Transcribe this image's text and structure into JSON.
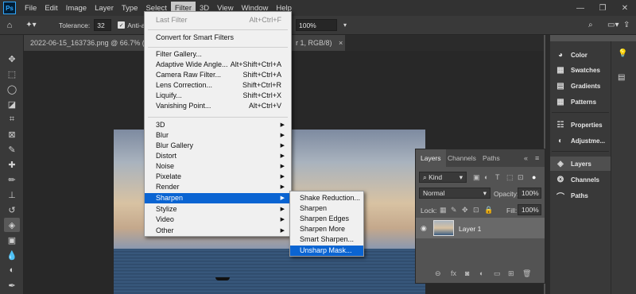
{
  "menubar": {
    "logo": "Ps",
    "items": [
      "File",
      "Edit",
      "Image",
      "Layer",
      "Type",
      "Select",
      "Filter",
      "3D",
      "View",
      "Window",
      "Help"
    ],
    "active": "Filter",
    "minimize": "—",
    "maximize": "❐",
    "close": "✕"
  },
  "options": {
    "tolerance_label": "Tolerance:",
    "tolerance_value": "32",
    "antialias_label": "Anti-alia",
    "opacity_value": "100%"
  },
  "tabs": {
    "doc1": "2022-06-15_163736.png @ 66.7% (RGB/",
    "doc2": "r 1, RGB/8)",
    "close": "×"
  },
  "filter_menu": {
    "last_filter": "Last Filter",
    "last_filter_sc": "Alt+Ctrl+F",
    "smart_filters": "Convert for Smart Filters",
    "items": [
      {
        "label": "Filter Gallery...",
        "sc": ""
      },
      {
        "label": "Adaptive Wide Angle...",
        "sc": "Alt+Shift+Ctrl+A"
      },
      {
        "label": "Camera Raw Filter...",
        "sc": "Shift+Ctrl+A"
      },
      {
        "label": "Lens Correction...",
        "sc": "Shift+Ctrl+R"
      },
      {
        "label": "Liquify...",
        "sc": "Shift+Ctrl+X"
      },
      {
        "label": "Vanishing Point...",
        "sc": "Alt+Ctrl+V"
      }
    ],
    "groups": [
      "3D",
      "Blur",
      "Blur Gallery",
      "Distort",
      "Noise",
      "Pixelate",
      "Render",
      "Sharpen",
      "Stylize",
      "Video",
      "Other"
    ],
    "highlighted": "Sharpen"
  },
  "sharpen_submenu": {
    "items": [
      "Shake Reduction...",
      "Sharpen",
      "Sharpen Edges",
      "Sharpen More",
      "Smart Sharpen...",
      "Unsharp Mask..."
    ],
    "highlighted": "Unsharp Mask..."
  },
  "layers_panel": {
    "tabs": [
      "Layers",
      "Channels",
      "Paths"
    ],
    "active_tab": "Layers",
    "kind": "Kind",
    "blend_mode": "Normal",
    "opacity_label": "Opacity:",
    "opacity_value": "100%",
    "lock_label": "Lock:",
    "fill_label": "Fill:",
    "fill_value": "100%",
    "layer_name": "Layer 1"
  },
  "right_dock": {
    "items": [
      "Color",
      "Swatches",
      "Gradients",
      "Patterns",
      "Properties",
      "Adjustme...",
      "Layers",
      "Channels",
      "Paths"
    ],
    "active": "Layers"
  },
  "colors": {
    "accent": "#0a64d2",
    "menubar": "#323232",
    "panel": "#535353"
  }
}
